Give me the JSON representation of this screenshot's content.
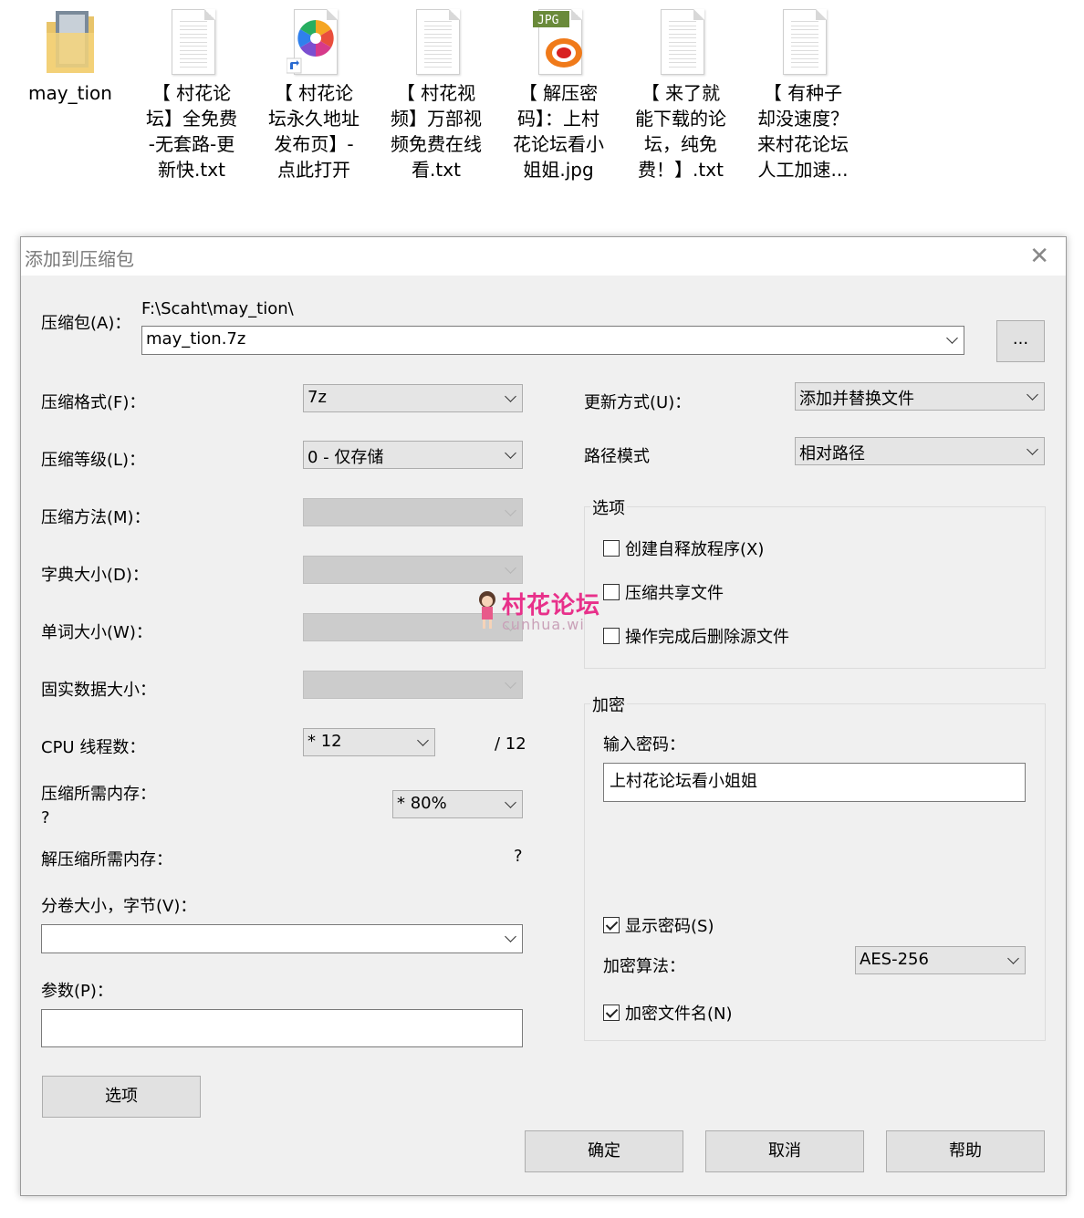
{
  "desktop": {
    "files": [
      {
        "name": "may_tion",
        "icon": "folder-icon"
      },
      {
        "name": "【 村花论坛】全免费-无套路-更新快.txt",
        "icon": "text-file-icon"
      },
      {
        "name": "【 村花论坛永久地址发布页】-点此打开",
        "icon": "shortcut-icon"
      },
      {
        "name": "【 村花视频】万部视频免费在线看.txt",
        "icon": "text-file-icon"
      },
      {
        "name": "【 解压密码】：上村花论坛看小姐姐.jpg",
        "icon": "jpg-file-icon"
      },
      {
        "name": "【 来了就能下载的论坛，纯免费！】.txt",
        "icon": "text-file-icon"
      },
      {
        "name": "【 有种子却没速度？来村花论坛人工加速...",
        "icon": "text-file-icon"
      }
    ],
    "names_lines": [
      [
        "may_tion"
      ],
      [
        "【 村花论",
        "坛】全免费",
        "-无套路-更",
        "新快.txt"
      ],
      [
        "【 村花论",
        "坛永久地址",
        "发布页】-",
        "点此打开"
      ],
      [
        "【 村花视",
        "频】万部视",
        "频免费在线",
        "看.txt"
      ],
      [
        "【 解压密",
        "码】：上村",
        "花论坛看小",
        "姐姐.jpg"
      ],
      [
        "【 来了就",
        "能下载的论",
        "坛，纯免",
        "费！】.txt"
      ],
      [
        "【 有种子",
        "却没速度？",
        "来村花论坛",
        "人工加速..."
      ]
    ]
  },
  "dialog": {
    "title": "添加到压缩包",
    "archive_label": "压缩包(A)：",
    "archive_path": "F:\\Scaht\\may_tion\\",
    "archive_name": "may_tion.7z",
    "browse_label": "...",
    "format_label": "压缩格式(F)：",
    "format_value": "7z",
    "level_label": "压缩等级(L)：",
    "level_value": "0 - 仅存储",
    "method_label": "压缩方法(M)：",
    "dict_label": "字典大小(D)：",
    "word_label": "单词大小(W)：",
    "solid_label": "固实数据大小：",
    "cpu_label": "CPU 线程数：",
    "cpu_value": "*  12",
    "cpu_total": "/ 12",
    "mem_label": "压缩所需内存：",
    "mem_value": "?",
    "mem_combo": "* 80%",
    "decomp_label": "解压缩所需内存：",
    "decomp_value": "?",
    "split_label": "分卷大小，字节(V)：",
    "params_label": "参数(P)：",
    "options_button": "选项",
    "update_label": "更新方式(U)：",
    "update_value": "添加并替换文件",
    "path_label": "路径模式",
    "path_value": "相对路径",
    "options_group": "选项",
    "opt_sfx": "创建自释放程序(X)",
    "opt_shared": "压缩共享文件",
    "opt_delete": "操作完成后删除源文件",
    "encrypt_group": "加密",
    "password_label": "输入密码：",
    "password_value": "上村花论坛看小姐姐",
    "show_password": "显示密码(S)",
    "algo_label": "加密算法：",
    "algo_value": "AES-256",
    "encrypt_names": "加密文件名(N)",
    "ok": "确定",
    "cancel": "取消",
    "help": "帮助"
  },
  "watermark": {
    "text": "村花论坛",
    "sub": "cunhua.wi"
  }
}
